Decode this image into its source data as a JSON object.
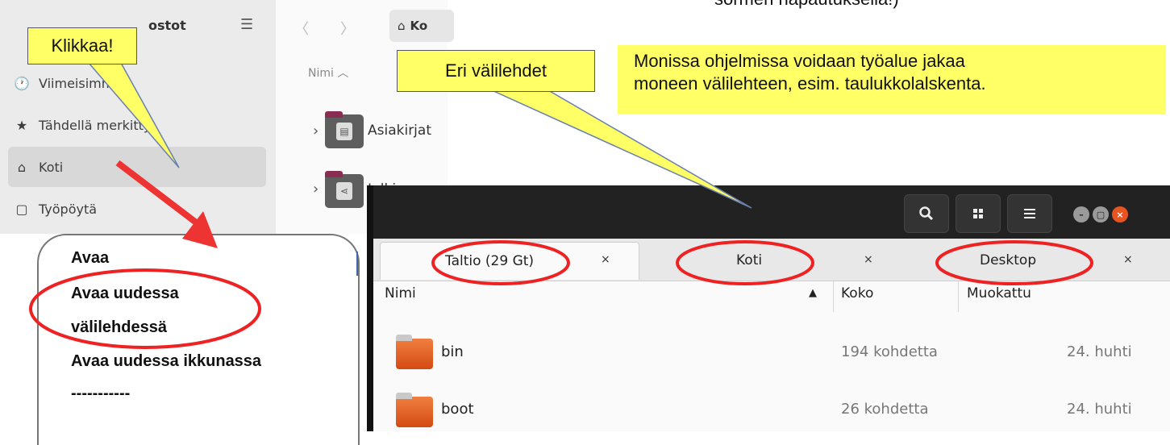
{
  "top_partial_text": "sormen napautuksella!)",
  "bg_fm": {
    "sidebar_title": "ostot",
    "items": [
      {
        "icon": "clock-icon",
        "glyph": "🕐",
        "label": "Viimeisimmät"
      },
      {
        "icon": "star-icon",
        "glyph": "★",
        "label": "Tähdellä merkitty"
      },
      {
        "icon": "home-icon",
        "glyph": "⌂",
        "label": "Koti"
      },
      {
        "icon": "desktop-icon",
        "glyph": "▢",
        "label": "Työpöytä"
      }
    ],
    "path": "Ko",
    "col_name": "Nimi",
    "folders": [
      {
        "name": "Asiakirjat"
      },
      {
        "name": "Julki"
      }
    ]
  },
  "context_menu": {
    "items": [
      "Avaa",
      "Avaa uudessa",
      "välilehdessä",
      "Avaa uudessa ikkunassa",
      "-----------"
    ]
  },
  "window": {
    "tabs": [
      {
        "label": "Taltio (29 Gt)",
        "close": "×"
      },
      {
        "label": "Koti",
        "close": "×"
      },
      {
        "label": "Desktop",
        "close": "×"
      }
    ],
    "columns": {
      "name": "Nimi",
      "size": "Koko",
      "modified": "Muokattu"
    },
    "rows": [
      {
        "name": "bin",
        "size": "194 kohdetta",
        "modified": "24. huhti"
      },
      {
        "name": "boot",
        "size": "26 kohdetta",
        "modified": "24. huhti"
      }
    ]
  },
  "callouts": {
    "click": "Klikkaa!",
    "tabs": "Eri välilehdet",
    "info_line1": "Monissa ohjelmissa voidaan työalue jakaa",
    "info_line2": "moneen välilehteen, esim. taulukkolalskenta."
  },
  "colors": {
    "highlight": "#ff0000",
    "callout": "#ffff66",
    "folder": "#e05a1c"
  }
}
